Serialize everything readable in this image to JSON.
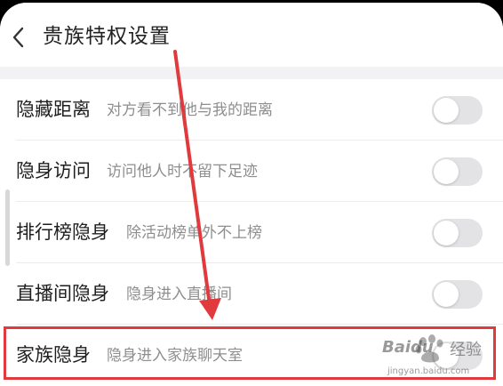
{
  "header": {
    "title": "贵族特权设置",
    "back_icon": "chevron-left-icon"
  },
  "settings": [
    {
      "title": "隐藏距离",
      "description": "对方看不到他与我的距离",
      "enabled": false
    },
    {
      "title": "隐身访问",
      "description": "访问他人时不留下足迹",
      "enabled": false
    },
    {
      "title": "排行榜隐身",
      "description": "除活动榜单外不上榜",
      "enabled": false
    },
    {
      "title": "直播间隐身",
      "description": "隐身进入直播间",
      "enabled": false
    },
    {
      "title": "家族隐身",
      "description": "隐身进入家族聊天室",
      "enabled": false
    }
  ],
  "annotation": {
    "arrow_color": "#e03a3e",
    "highlight_color": "#e03a3e",
    "highlighted_item": "家族隐身"
  },
  "watermark": {
    "brand": "Baidu",
    "suffix": "经验",
    "url": "jingyan.baidu.com"
  },
  "colors": {
    "toggle_off": "#e3e3e6",
    "section_gap": "#f2f2f4"
  }
}
